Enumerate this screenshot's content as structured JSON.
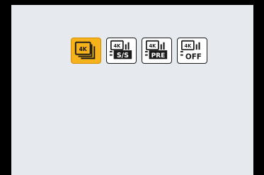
{
  "photo_modes": {
    "selected_index": 0,
    "items": [
      {
        "id": "4k-burst",
        "icon": "4k-burst-icon",
        "label": "4K"
      },
      {
        "id": "4k-burst-start-stop",
        "icon": "4k-burst-start-stop-icon",
        "label": "4K",
        "sub_label": "S/S"
      },
      {
        "id": "4k-pre-burst",
        "icon": "4k-pre-burst-icon",
        "label": "4K",
        "sub_label": "PRE"
      },
      {
        "id": "4k-burst-off",
        "icon": "4k-off-icon",
        "label": "4K",
        "sub_label": "OFF"
      }
    ]
  },
  "colors": {
    "selected_bg": "#f6b21b",
    "panel_bg": "#e6eaee",
    "frame": "#000000"
  }
}
